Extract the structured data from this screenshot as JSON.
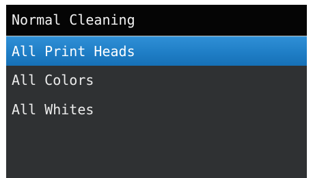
{
  "screen": {
    "title": "Normal Cleaning"
  },
  "menu": {
    "items": [
      {
        "label": "All Print Heads",
        "selected": true
      },
      {
        "label": "All Colors",
        "selected": false
      },
      {
        "label": "All Whites",
        "selected": false
      }
    ]
  },
  "colors": {
    "title_bar_bg": "#050505",
    "screen_bg": "#2f3133",
    "selection_accent": "#1f7ec6",
    "text": "#ececec"
  }
}
